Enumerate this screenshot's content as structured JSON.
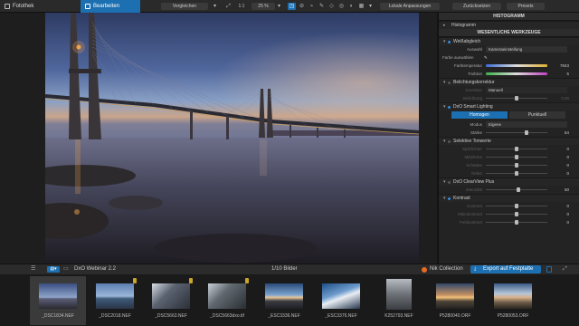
{
  "toolbar": {
    "tab_library": "Fotothek",
    "tab_edit": "Bearbeiten",
    "compare_label": "Vergleichen",
    "ratio_label": "1:1",
    "zoom_value": "25 %",
    "local_adjust_label": "Lokale Anpassungen",
    "reset_label": "Zurücksetzen",
    "presets_label": "Presets"
  },
  "panel": {
    "histogram_header": "HISTOGRAMM",
    "histogram_group": "Histogramm",
    "essential_header": "WESENTLICHE WERKZEUGE",
    "white_balance": {
      "title": "Weißabgleich",
      "selection_label": "Auswahl",
      "selection_value": "Kameraeinstellung",
      "pick_color_label": "Farbe auswählen",
      "temp_label": "Farbtemperatur",
      "temp_value": "7843",
      "tint_label": "Farbton",
      "tint_value": "5"
    },
    "exposure": {
      "title": "Belichtungskorrektur",
      "mode_label": "Korrektur",
      "mode_value": "Manuell",
      "exposure_label": "Belichtung",
      "exposure_value": "0,00"
    },
    "smart_lighting": {
      "title": "DxO Smart Lighting",
      "seg_homogen": "Homogen",
      "seg_spot": "Punktuell",
      "mode_label": "Modus",
      "mode_value": "Eigene",
      "strength_label": "Stärke",
      "strength_value": "64"
    },
    "selective_tone": {
      "title": "Selektive Tonwerte",
      "highlights_label": "Spitzlichter",
      "highlights_value": "0",
      "midtones_label": "Mitteltöne",
      "midtones_value": "0",
      "shadows_label": "Schatten",
      "shadows_value": "0",
      "blacks_label": "Tiefen",
      "blacks_value": "0"
    },
    "clearview": {
      "title": "DxO ClearView Plus",
      "intensity_label": "Intensität",
      "intensity_value": "50"
    },
    "contrast": {
      "title": "Kontrast",
      "contrast_label": "Kontrast",
      "contrast_value": "0",
      "microcontrast_label": "Mikrokontrast",
      "microcontrast_value": "0",
      "finecontrast_label": "Feinkontrast",
      "finecontrast_value": "0"
    }
  },
  "stripbar": {
    "folder_label": "DxO Webinar 2.2",
    "count_label": "1/10 Bilder",
    "nik_label": "Nik Collection",
    "export_label": "Export auf Festplatte"
  },
  "filmstrip": [
    {
      "name": "_DSC1834.NEF"
    },
    {
      "name": "_DSC2018.NEF"
    },
    {
      "name": "_DSC5663.NEF"
    },
    {
      "name": "_DSC5663dxo.tif"
    },
    {
      "name": "_ESC3336.NEF"
    },
    {
      "name": "_ESC3376.NEF"
    },
    {
      "name": "K252793.NEF"
    },
    {
      "name": "P5280040.ORF"
    },
    {
      "name": "P5280053.ORF"
    }
  ]
}
